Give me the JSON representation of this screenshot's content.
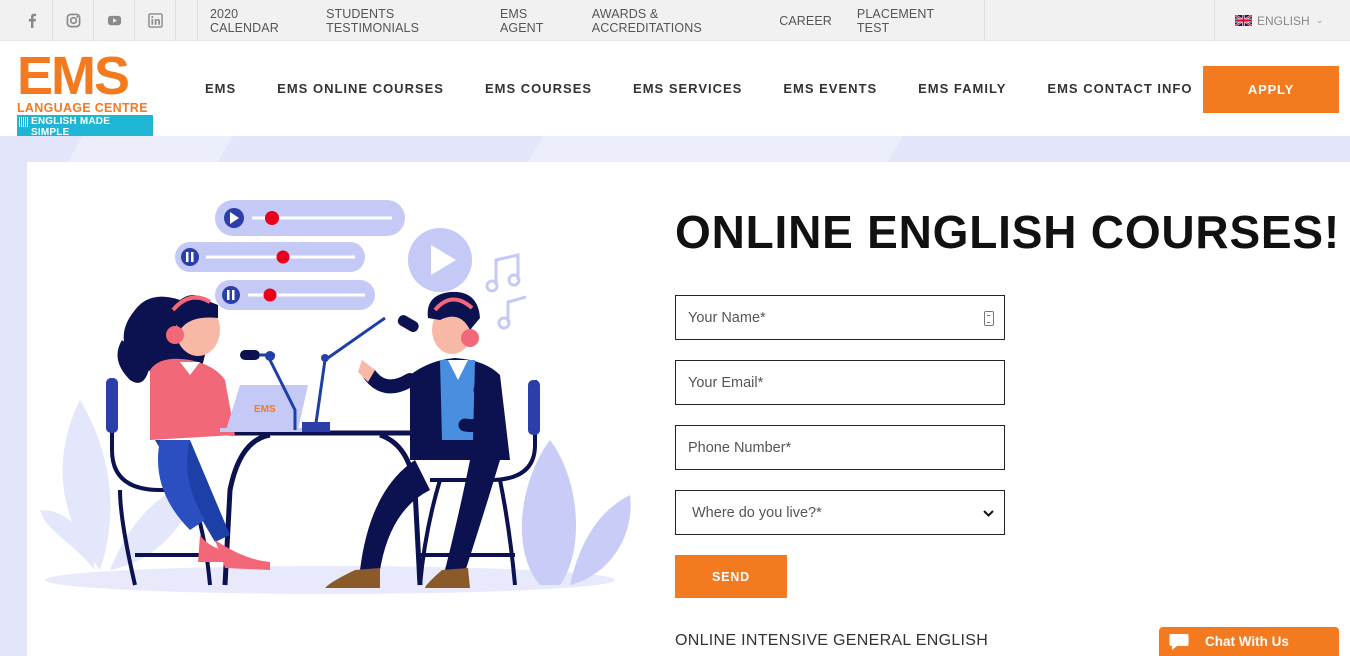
{
  "topbar": {
    "social": [
      {
        "name": "facebook-icon",
        "glyph": "f"
      },
      {
        "name": "instagram-icon",
        "glyph": ""
      },
      {
        "name": "youtube-icon",
        "glyph": ""
      },
      {
        "name": "linkedin-icon",
        "glyph": ""
      }
    ],
    "links": [
      "2020 CALENDAR",
      "STUDENTS TESTIMONIALS",
      "EMS AGENT",
      "AWARDS & ACCREDITATIONS",
      "CAREER",
      "PLACEMENT TEST"
    ],
    "language": "ENGLISH"
  },
  "header": {
    "logo": {
      "brand": "EMS",
      "line1": "LANGUAGE CENTRE",
      "line2": "ENGLISH MADE SIMPLE"
    },
    "nav": [
      "EMS",
      "EMS ONLINE COURSES",
      "EMS COURSES",
      "EMS SERVICES",
      "EMS EVENTS",
      "EMS FAMILY",
      "EMS CONTACT INFO"
    ],
    "apply_label": "APPLY"
  },
  "main": {
    "title": "ONLINE ENGLISH COURSES!",
    "illustration_badge": "EMS",
    "form": {
      "name_placeholder": "Your Name*",
      "email_placeholder": "Your Email*",
      "phone_placeholder": "Phone Number*",
      "location_value": "Where do you live?*",
      "send_label": "SEND"
    },
    "subtitle": "ONLINE INTENSIVE GENERAL ENGLISH"
  },
  "chat": {
    "label": "Chat With Us"
  },
  "colors": {
    "accent": "#f47a20",
    "cyan": "#1fb6d6",
    "lavender": "#e3e5fb"
  }
}
